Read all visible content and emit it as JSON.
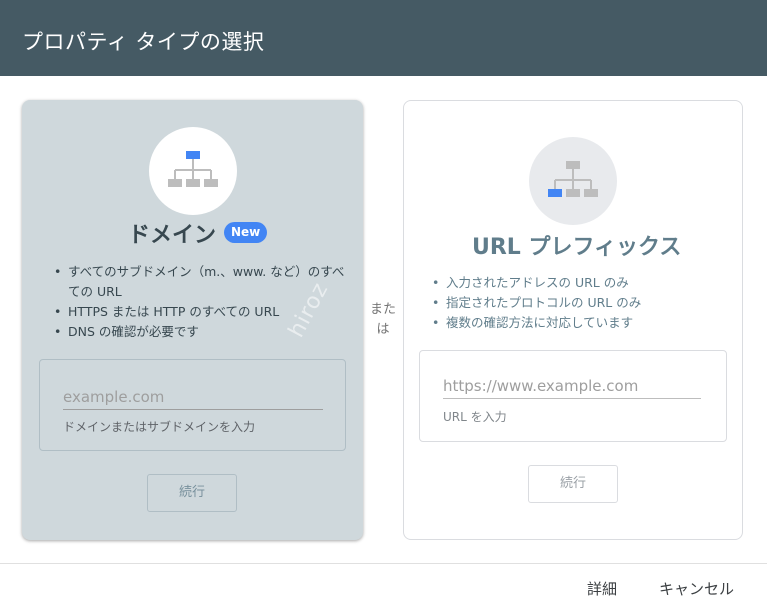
{
  "dialog": {
    "title": "プロパティ タイプの選択",
    "or_label": "または",
    "watermark": "hiroz"
  },
  "domain_card": {
    "title": "ドメイン",
    "badge": "New",
    "icon": "domain-sitemap-icon",
    "bullets": [
      "すべてのサブドメイン（m.、www. など）のすべての URL",
      "HTTPS または HTTP のすべての URL",
      "DNS の確認が必要です"
    ],
    "input_placeholder": "example.com",
    "input_value": "",
    "input_help": "ドメインまたはサブドメインを入力",
    "continue_label": "続行"
  },
  "prefix_card": {
    "title": "URL プレフィックス",
    "icon": "url-prefix-sitemap-icon",
    "bullets": [
      "入力されたアドレスの URL のみ",
      "指定されたプロトコルの URL のみ",
      "複数の確認方法に対応しています"
    ],
    "input_placeholder": "https://www.example.com",
    "input_value": "",
    "input_help": "URL を入力",
    "continue_label": "続行"
  },
  "footer": {
    "details_label": "詳細",
    "cancel_label": "キャンセル"
  },
  "colors": {
    "header_bg": "#455a64",
    "domain_card_bg": "#cfd8dc",
    "accent_blue": "#4285f4",
    "icon_gray": "#bdbdbd"
  }
}
